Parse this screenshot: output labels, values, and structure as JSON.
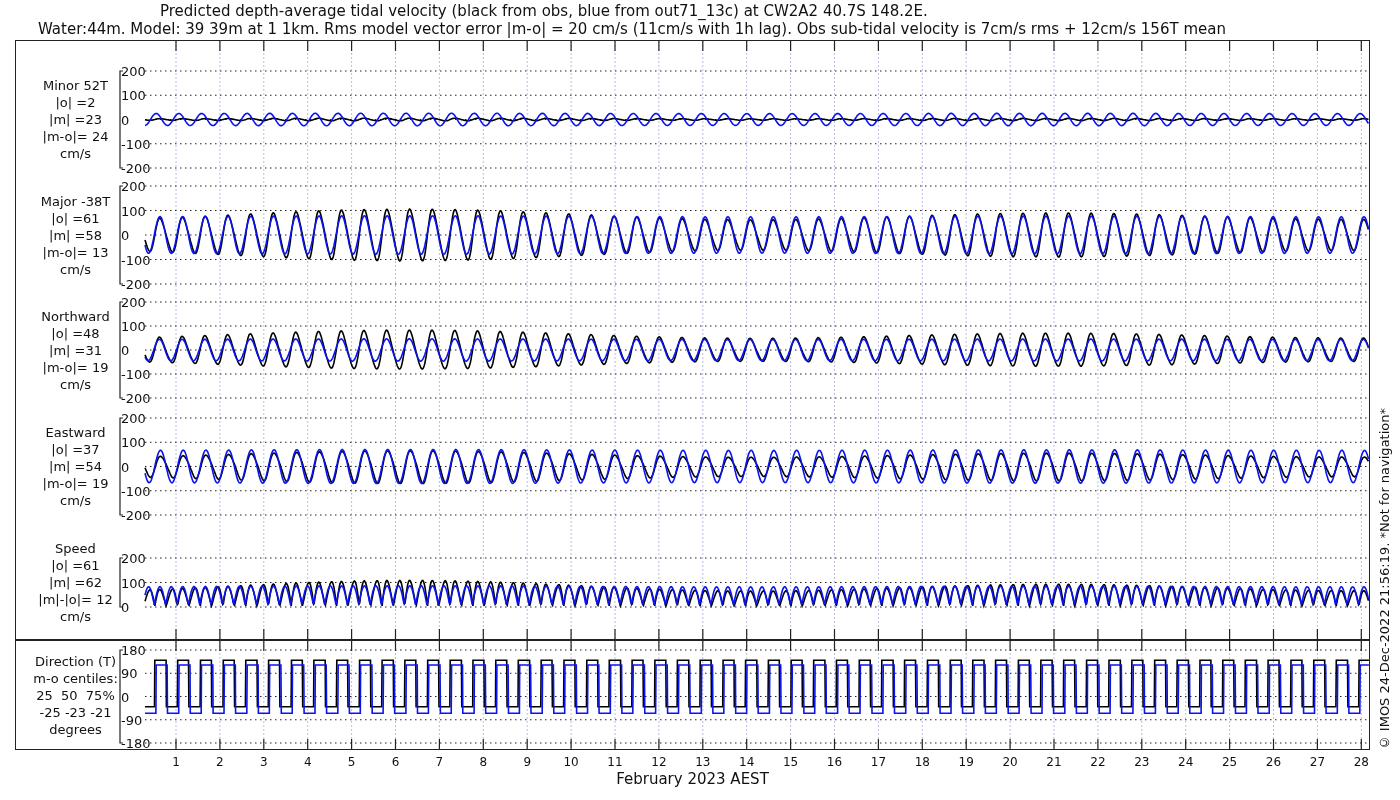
{
  "title": {
    "lines": [
      "Predicted depth-average tidal velocity (black from obs, blue from out71_13c) at CW2A2 40.7S 148.2E.",
      "Water:44m. Model: 39 39m at 1 1km. Rms model vector error |m-o| = 20 cm/s (11cm/s with 1h lag). Obs sub-tidal velocity is 7cm/s rms + 12cm/s 156T mean"
    ]
  },
  "panels": [
    {
      "kind": "signed",
      "label_lines": [
        "Minor 52T",
        "|o| =2",
        "|m| =23",
        "|m-o|= 24",
        "cm/s"
      ],
      "yticks": [
        "200",
        "100",
        "0",
        "-100",
        "-200"
      ]
    },
    {
      "kind": "signed",
      "label_lines": [
        "Major -38T",
        "|o| =61",
        "|m| =58",
        "|m-o|= 13",
        "cm/s"
      ],
      "yticks": [
        "200",
        "100",
        "0",
        "-100",
        "-200"
      ]
    },
    {
      "kind": "signed",
      "label_lines": [
        "Northward",
        "|o| =48",
        "|m| =31",
        "|m-o|= 19",
        "cm/s"
      ],
      "yticks": [
        "200",
        "100",
        "0",
        "-100",
        "-200"
      ]
    },
    {
      "kind": "signed",
      "label_lines": [
        "Eastward",
        "|o| =37",
        "|m| =54",
        "|m-o|= 19",
        "cm/s"
      ],
      "yticks": [
        "200",
        "100",
        "0",
        "-100",
        "-200"
      ]
    },
    {
      "kind": "positive",
      "label_lines": [
        "Speed",
        "|o| =61",
        "|m| =62",
        "|m|-|o|= 12",
        "cm/s"
      ],
      "yticks": [
        "200",
        "100",
        "0"
      ]
    }
  ],
  "direction_panel": {
    "label_lines": [
      "Direction (T)",
      "m-o centiles:",
      "25  50  75%",
      "-25 -23 -21",
      "degrees"
    ],
    "yticks": [
      "180",
      "90",
      "0",
      "-90",
      "-180"
    ]
  },
  "xticks": [
    "1",
    "2",
    "3",
    "4",
    "5",
    "6",
    "7",
    "8",
    "9",
    "10",
    "11",
    "12",
    "13",
    "14",
    "15",
    "16",
    "17",
    "18",
    "19",
    "20",
    "21",
    "22",
    "23",
    "24",
    "25",
    "26",
    "27",
    "28"
  ],
  "xlabel": "February 2023 AEST",
  "credit": "© IMOS 24-Dec-2022 21:56:19. *Not for navigation*"
}
